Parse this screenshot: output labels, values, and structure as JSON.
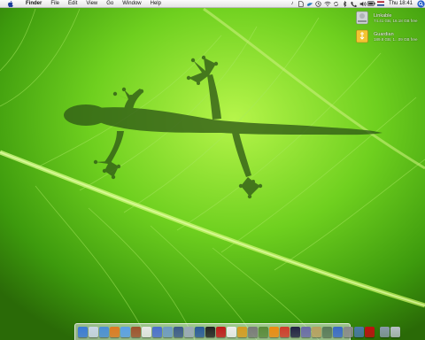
{
  "menubar": {
    "app_name": "Finder",
    "items": [
      "File",
      "Edit",
      "View",
      "Go",
      "Window",
      "Help"
    ],
    "clock": "Thu 18:41"
  },
  "drives": [
    {
      "name": "Linkable",
      "info": "74.41 GB, 16.18 GB free",
      "color": "#c8c8c8"
    },
    {
      "name": "Guardian",
      "info": "189.8 GB, 1...09 GB free",
      "color": "#f3c431"
    }
  ],
  "dock": {
    "icons": [
      {
        "name": "finder-icon",
        "color": "#3a7ad8"
      },
      {
        "name": "mail-icon",
        "color": "#c9d6e6"
      },
      {
        "name": "safari-icon",
        "color": "#4a8fd8"
      },
      {
        "name": "firefox-icon",
        "color": "#e07a20"
      },
      {
        "name": "ichat-icon",
        "color": "#5aa0e8"
      },
      {
        "name": "address-book-icon",
        "color": "#a0522d"
      },
      {
        "name": "ical-icon",
        "color": "#e8e8e8"
      },
      {
        "name": "itunes-icon",
        "color": "#4b6fd0"
      },
      {
        "name": "iphoto-icon",
        "color": "#6e9ac4"
      },
      {
        "name": "imovie-icon",
        "color": "#3c5a8a"
      },
      {
        "name": "preview-icon",
        "color": "#9aa8b8"
      },
      {
        "name": "photoshop-icon",
        "color": "#2a5a9a"
      },
      {
        "name": "terminal-icon",
        "color": "#222222"
      },
      {
        "name": "acrobat-icon",
        "color": "#c21a1a"
      },
      {
        "name": "textedit-icon",
        "color": "#eeeeee"
      },
      {
        "name": "network-icon",
        "color": "#d89b20"
      },
      {
        "name": "utility-icon",
        "color": "#7a7a7a"
      },
      {
        "name": "chess-icon",
        "color": "#5a8a3a"
      },
      {
        "name": "vlc-icon",
        "color": "#ef8a10"
      },
      {
        "name": "flash-icon",
        "color": "#d23a2a"
      },
      {
        "name": "dashboard-icon",
        "color": "#222244"
      },
      {
        "name": "widget-icon",
        "color": "#6a6aaa"
      },
      {
        "name": "tools-icon",
        "color": "#b8a060"
      },
      {
        "name": "script-icon",
        "color": "#5a7a5a"
      },
      {
        "name": "xcode-icon",
        "color": "#3a6ac8"
      },
      {
        "name": "system-prefs-icon",
        "color": "#8a8a8a"
      },
      {
        "name": "app-store-icon",
        "color": "#4a7aa8"
      },
      {
        "name": "stop-icon",
        "color": "#c01010"
      }
    ],
    "right_icons": [
      {
        "name": "downloads-stack-icon",
        "color": "#8a9aaa"
      },
      {
        "name": "trash-icon",
        "color": "#b8c0c8"
      }
    ]
  }
}
